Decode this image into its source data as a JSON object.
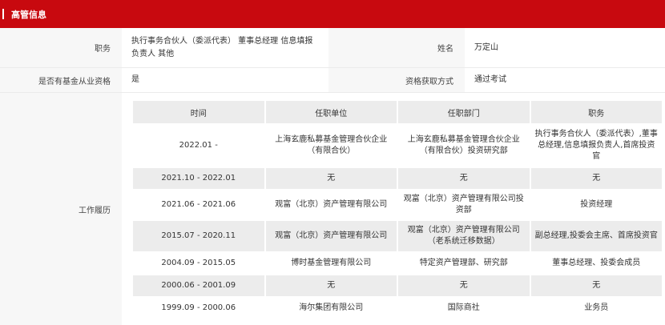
{
  "header": {
    "title": "高管信息"
  },
  "info": {
    "position_label": "职务",
    "position_value": "执行事务合伙人（委派代表） 董事总经理 信息填报负责人 其他",
    "name_label": "姓名",
    "name_value": "万定山",
    "qualification_label": "是否有基金从业资格",
    "qualification_value": "是",
    "acquire_label": "资格获取方式",
    "acquire_value": "通过考试",
    "history_label": "工作履历"
  },
  "history": {
    "columns": [
      "时间",
      "任职单位",
      "任职部门",
      "职务"
    ],
    "rows": [
      [
        "2022.01 -",
        "上海玄鹿私募基金管理合伙企业（有限合伙）",
        "上海玄鹿私募基金管理合伙企业（有限合伙）投资研究部",
        "执行事务合伙人（委派代表）,董事总经理,信息填报负责人,首席投资官"
      ],
      [
        "2021.10 - 2022.01",
        "无",
        "无",
        "无"
      ],
      [
        "2021.06 - 2021.06",
        "观富（北京）资产管理有限公司",
        "观富（北京）资产管理有限公司投资部",
        "投资经理"
      ],
      [
        "2015.07 - 2020.11",
        "观富（北京）资产管理有限公司",
        "观富（北京）资产管理有限公司（老系统迁移数据）",
        "副总经理,投委会主席、首席投资官"
      ],
      [
        "2004.09 - 2015.05",
        "博时基金管理有限公司",
        "特定资产管理部、研究部",
        "董事总经理、投委会成员"
      ],
      [
        "2000.06 - 2001.09",
        "无",
        "无",
        "无"
      ],
      [
        "1999.09 - 2000.06",
        "海尔集团有限公司",
        "国际商社",
        "业务员"
      ]
    ]
  }
}
